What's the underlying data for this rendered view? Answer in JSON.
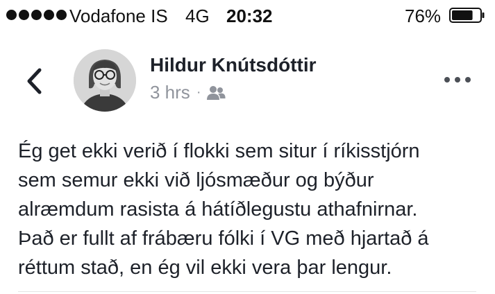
{
  "status_bar": {
    "carrier": "Vodafone IS",
    "network": "4G",
    "time": "20:32",
    "battery_percent": "76%",
    "battery_level": 0.76,
    "signal_bars": 5
  },
  "header": {
    "back_icon": "chevron-left-icon",
    "author_name": "Hildur Knútsdóttir",
    "timestamp": "3 hrs",
    "separator": "·",
    "audience_icon": "friends-icon",
    "more_icon": "more-horizontal-icon"
  },
  "post": {
    "lines": [
      "Ég get ekki verið í flokki sem situr í ríkisstjórn",
      "sem semur ekki við ljósmæður og býður",
      "alræmdum rasista á hátíðlegustu athafnirnar.",
      "Það er fullt af frábæru fólki í VG með hjartað á",
      "réttum stað, en ég vil ekki vera þar lengur."
    ]
  },
  "colors": {
    "text": "#1d2129",
    "secondary": "#90949c",
    "icon": "#4b4f56"
  }
}
